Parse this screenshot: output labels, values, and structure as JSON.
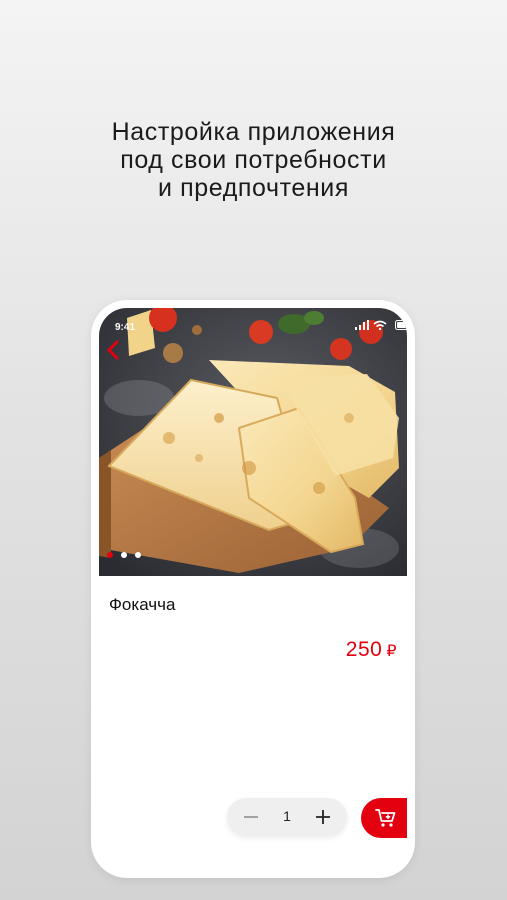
{
  "promo": {
    "headline_lines": [
      "Настройка приложения",
      "под свои потребности",
      "и предпочтения"
    ]
  },
  "status_bar": {
    "time": "9:41"
  },
  "product": {
    "name": "Фокачча",
    "price": "250",
    "currency": "₽",
    "image_carousel": {
      "count": 3,
      "active_index": 0
    }
  },
  "cart": {
    "quantity": "1"
  },
  "icons": {
    "back": "chevron-left-icon",
    "minus": "minus-icon",
    "plus": "plus-icon",
    "cart": "cart-add-icon",
    "signal": "signal-icon",
    "wifi": "wifi-icon",
    "battery": "battery-icon"
  },
  "colors": {
    "accent": "#e3000f",
    "background": "#e3e3e3",
    "card": "#ffffff"
  }
}
